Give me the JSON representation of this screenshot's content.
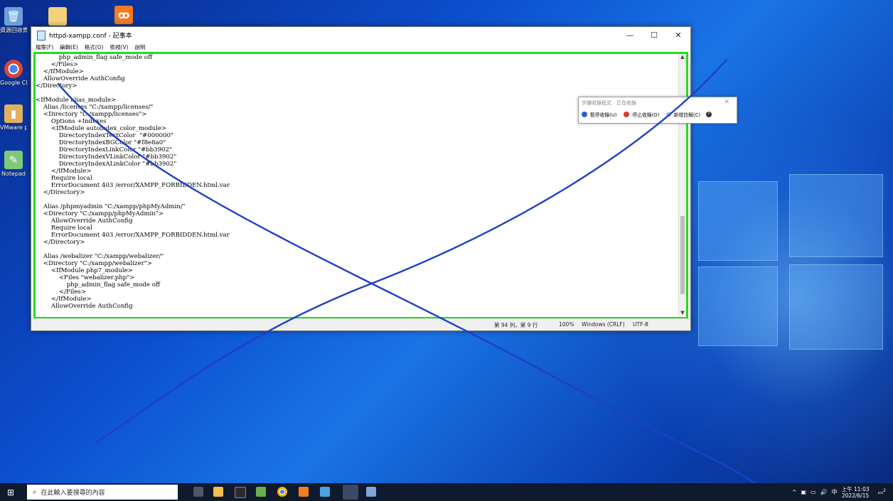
{
  "desktop": {
    "icons": [
      {
        "label": "資源回收筒",
        "glyph": "🗑",
        "color": "#6aa0d8"
      },
      {
        "label": "Google Chrome",
        "glyph": "◉",
        "color": "#e8e8e8"
      },
      {
        "label": "VMware phpMyad",
        "glyph": "▮",
        "color": "#e0b060"
      },
      {
        "label": "Notepad",
        "glyph": "✎",
        "color": "#7fc77a"
      }
    ]
  },
  "notepad": {
    "title": "httpd-xampp.conf - 記事本",
    "menu": [
      "檔案(F)",
      "編輯(E)",
      "格式(O)",
      "檢視(V)",
      "說明"
    ],
    "window_buttons": {
      "minimize": "—",
      "maximize": "☐",
      "close": "✕"
    },
    "content": "            php_admin_flag safe_mode off\n        </Files>\n    </IfModule>\n    AllowOverride AuthConfig\n</Directory>\n\n<IfModule alias_module>\n    Alias /licenses \"C:/xampp/licenses/\"\n    <Directory \"C:/xampp/licenses\">\n        Options +Indexes\n        <IfModule autoindex_color_module>\n            DirectoryIndexTextColor  \"#000000\"\n            DirectoryIndexBGColor \"#f8e8a0\"\n            DirectoryIndexLinkColor \"#bb3902\"\n            DirectoryIndexVLinkColor \"#bb3902\"\n            DirectoryIndexALinkColor \"#bb3902\"\n        </IfModule>\n        Require local\n        ErrorDocument 403 /error/XAMPP_FORBIDDEN.html.var\n    </Directory>\n\n    Alias /phpmyadmin \"C:/xampp/phpMyAdmin/\"\n    <Directory \"C:/xampp/phpMyAdmin\">\n        AllowOverride AuthConfig\n        Require local\n        ErrorDocument 403 /error/XAMPP_FORBIDDEN.html.var\n    </Directory>\n\n    Alias /webalizer \"C:/xampp/webalizer/\"\n    <Directory \"C:/xampp/webalizer\">\n        <IfModule php7_module>\n            <Files \"webalizer.php\">\n                php_admin_flag safe_mode off\n            </Files>\n        </IfModule>\n        AllowOverride AuthConfig",
    "status": {
      "position": "第 94 列，第 9 行",
      "zoom": "100%",
      "line_ending": "Windows (CRLF)",
      "encoding": "UTF-8"
    },
    "highlight_color": "#22dd22"
  },
  "steps_recorder": {
    "title": "步驟收錄程式 - 正在收錄",
    "pause_label": "暫停收錄(U)",
    "stop_label": "停止收錄(O)",
    "comment_label": "新增註解(C)",
    "help_label": "?"
  },
  "taskbar": {
    "search_placeholder": "在此輸入要搜尋的內容",
    "tray_input": "中",
    "time": "上午 11:03",
    "date": "2022/6/15",
    "notification_count": "2"
  },
  "annotation_color": "#1f3fc8"
}
